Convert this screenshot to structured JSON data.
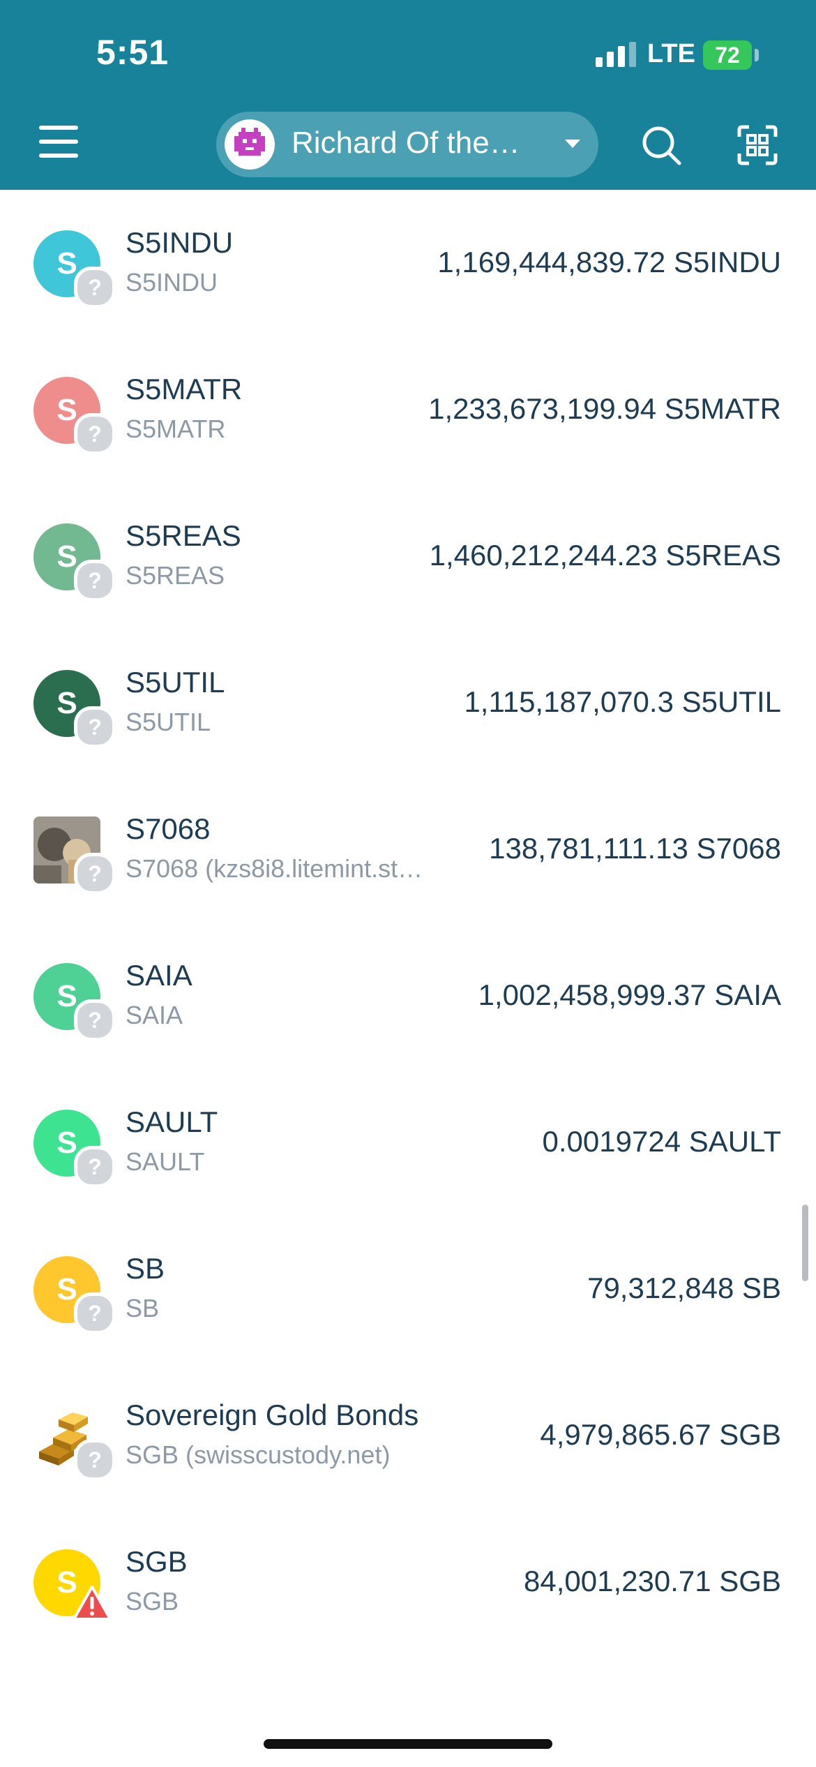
{
  "status_bar": {
    "time": "5:51",
    "network": "LTE",
    "battery": "72"
  },
  "header": {
    "account_name": "Richard Of the…",
    "icons": {
      "menu": "hamburger-menu-icon",
      "search": "search-icon",
      "scan": "qr-scan-icon",
      "avatar": "pixel-avatar-icon",
      "caret": "chevron-down-icon"
    }
  },
  "tokens": [
    {
      "letter": "S",
      "name": "S5INDU",
      "sub": "S5INDU",
      "balance": "1,169,444,839.72 S5INDU",
      "color": "#3fc7d9",
      "badge": "?"
    },
    {
      "letter": "S",
      "name": "S5MATR",
      "sub": "S5MATR",
      "balance": "1,233,673,199.94 S5MATR",
      "color": "#ef8d8d",
      "badge": "?"
    },
    {
      "letter": "S",
      "name": "S5REAS",
      "sub": "S5REAS",
      "balance": "1,460,212,244.23 S5REAS",
      "color": "#72b891",
      "badge": "?"
    },
    {
      "letter": "S",
      "name": "S5UTIL",
      "sub": "S5UTIL",
      "balance": "1,115,187,070.3 S5UTIL",
      "color": "#2b6e4f",
      "badge": "?"
    },
    {
      "letter": "",
      "name": "S7068",
      "sub": "S7068 (kzs8i8.litemint.st…",
      "balance": "138,781,111.13 S7068",
      "color": "#8f8a82",
      "badge": "?",
      "image": "photo-token-icon"
    },
    {
      "letter": "S",
      "name": "SAIA",
      "sub": "SAIA",
      "balance": "1,002,458,999.37 SAIA",
      "color": "#4fd095",
      "badge": "?"
    },
    {
      "letter": "S",
      "name": "SAULT",
      "sub": "SAULT",
      "balance": "0.0019724 SAULT",
      "color": "#3ee392",
      "badge": "?"
    },
    {
      "letter": "S",
      "name": "SB",
      "sub": "SB",
      "balance": "79,312,848 SB",
      "color": "#ffc72e",
      "badge": "?"
    },
    {
      "letter": "",
      "name": "Sovereign Gold Bonds",
      "sub": "SGB (swisscustody.net)",
      "balance": "4,979,865.67 SGB",
      "color": "#ffffff",
      "badge": "?",
      "image": "gold-bars-icon"
    },
    {
      "letter": "S",
      "name": "SGB",
      "sub": "SGB",
      "balance": "84,001,230.71 SGB",
      "color": "#ffd800",
      "badge": "warning"
    }
  ]
}
